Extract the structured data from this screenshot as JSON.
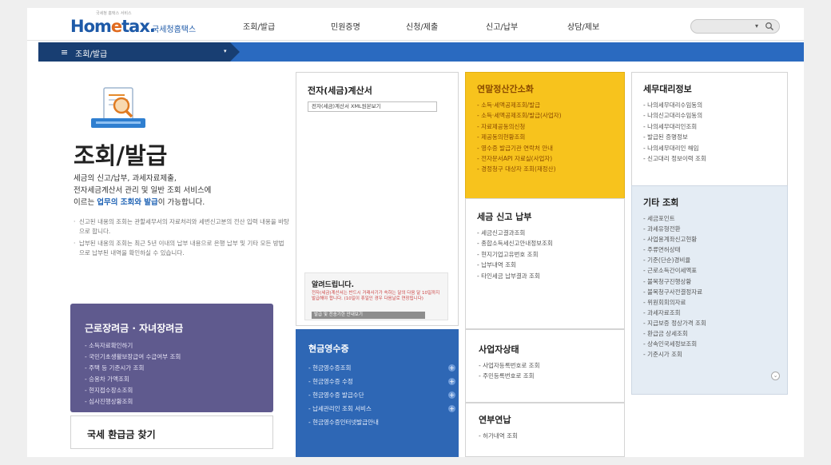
{
  "logo": {
    "text_a": "Hom",
    "text_b": "e",
    "text_c": "tax.",
    "tagline": "국세청홈택스",
    "small": "국세청 홈택스 서비스"
  },
  "nav": {
    "items": [
      "조회/발급",
      "민원증명",
      "신청/제출",
      "신고/납부",
      "상담/제보"
    ]
  },
  "search": {
    "arrow": "▾"
  },
  "breadcrumb": {
    "menu_label": "조회/발급",
    "hamburger": "≡",
    "caret": "▾"
  },
  "hero": {
    "title": "조회/발급",
    "desc_1": "세금의 신고/납부, 과세자료제출,",
    "desc_2": "전자세금계산서 관리 및 일반 조회 서비스에",
    "desc_3a": "이르는 ",
    "desc_3b": "업무의 조회와 발급",
    "desc_3c": "이 가능합니다.",
    "notes": [
      "신고된 내용의 조회는 관할세무서의 자료처리와 세번신고분의 전산 입력 내용을 바탕으로 합니다.",
      "납부된 내용의 조회는 최근 5년 이내의 납부 내용으로 은행 납부 및 기타 모든 방법으로 납부된 내역을 확인하실 수 있습니다."
    ]
  },
  "earned_credit": {
    "title": "근로장려금 · 자녀장려금",
    "items": [
      "소득자료확인하기",
      "국민기초생활보장급여 수급여부 조회",
      "주택 등 기준시가 조회",
      "승용차 가액조회",
      "현지접수장소조회",
      "심사진행상황조회"
    ]
  },
  "refund": {
    "title": "국세 환급금 찾기"
  },
  "einvoice": {
    "title": "전자(세금)계산서",
    "button": "전자(세금)계산서 XML원본보기"
  },
  "notice": {
    "title": "알려드립니다.",
    "body": "전자(세금)계산서는 반드시 거래사기가 속하는 달의 다음 달 10일까지 발급해야 합니다. (10일이 휴일인 경우 다음날로 연장됩니다)",
    "button": "발급 및 전송기한 안내보기"
  },
  "cash_receipt": {
    "title": "현금영수증",
    "items": [
      "현금영수증조회",
      "현금영수증 수정",
      "현금영수증 발급수단",
      "납세관리인 조회 서비스",
      "현금영수증인터넷발급안내"
    ],
    "plus": "+"
  },
  "year_end": {
    "title": "연말정산간소화",
    "items": [
      "소득·세액공제조회/발급",
      "소득·세액공제조회/발급(사업자)",
      "자료제공동의신청",
      "제공동의현황조회",
      "영수증 발급기관 연락처 안내",
      "전자문서API 자료실(사업자)",
      "경정청구 대상자 조회(재정산)"
    ]
  },
  "tax_filing": {
    "title": "세금 신고 납부",
    "items": [
      "세금신고결과조회",
      "종합소득세신고안내정보조회",
      "현지기업고유번호 조회",
      "납부내역 조회",
      "타인세금 납부결과 조회"
    ]
  },
  "business_status": {
    "title": "사업자상태",
    "items": [
      "사업자등록번호로 조회",
      "주민등록번호로 조회"
    ]
  },
  "pension": {
    "title": "연부연납",
    "items": [
      "허가내역 조회"
    ]
  },
  "agent_info": {
    "title": "세무대리정보",
    "items": [
      "나의세무대리수임동의",
      "나의신고대리수임동의",
      "나의세무대리인조회",
      "발급된 증명정보",
      "나의세무대리인 해임",
      "신고대리 정보이력 조회"
    ]
  },
  "other": {
    "title": "기타 조회",
    "items": [
      "세금포인트",
      "과세유형전환",
      "사업용계좌신고현황",
      "주류면허상태",
      "기준(단순)경비율",
      "근로소득간이세액표",
      "불복청구진행상황",
      "불복청구사전결정자료",
      "위원회회의자료",
      "과세자료조회",
      "지급보증 정상가격 조회",
      "환급금 상세조회",
      "상속인국세정보조회",
      "기준시가 조회"
    ],
    "more": "⌄"
  },
  "colors": {
    "blue_bar": "#2a6ac0",
    "dark_blue": "#183e72",
    "yellow": "#f7c31d",
    "purple": "#5f5a8e",
    "cash_blue": "#2e67b5",
    "other_bg": "#e4ecf4"
  },
  "icons": {
    "search": "magnifier-icon",
    "hero": "document-search-icon"
  }
}
